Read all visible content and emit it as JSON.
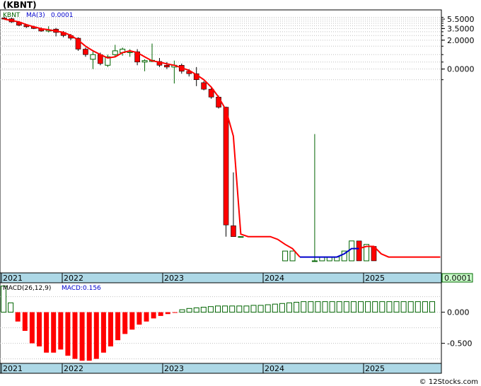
{
  "ticker_label": "(KBNT)",
  "credit": "© 12Stocks.com",
  "colors": {
    "up": "#006400",
    "down": "#ff0000",
    "ma": "#ff0000",
    "ma_recent": "#0000cc",
    "axis_band": "#add8e6",
    "grid": "#c0c0c0",
    "price_badge": "#ccffcc"
  },
  "chart_data": [
    {
      "type": "candlestick",
      "legend": {
        "symbol": "KBNT",
        "ma_label": "MA(3)",
        "ma_value": "0.0001"
      },
      "current_price_label": "0.0001",
      "y_scale": "log",
      "y_tick_labels": [
        "5.5000",
        "3.5000",
        "2.0000",
        "0.0000"
      ],
      "x_tick_labels": [
        "2021",
        "2022",
        "2023",
        "2024",
        "2025"
      ],
      "candles": [
        {
          "o": 5.8,
          "h": 6.2,
          "l": 5.4,
          "c": 5.5
        },
        {
          "o": 5.6,
          "h": 5.9,
          "l": 4.6,
          "c": 4.8
        },
        {
          "o": 4.7,
          "h": 5.0,
          "l": 3.9,
          "c": 4.1
        },
        {
          "o": 4.1,
          "h": 4.3,
          "l": 3.6,
          "c": 3.8
        },
        {
          "o": 3.8,
          "h": 4.0,
          "l": 3.4,
          "c": 3.5
        },
        {
          "o": 3.5,
          "h": 3.7,
          "l": 3.0,
          "c": 3.1
        },
        {
          "o": 3.1,
          "h": 3.9,
          "l": 2.9,
          "c": 3.3
        },
        {
          "o": 3.4,
          "h": 3.6,
          "l": 2.4,
          "c": 2.9
        },
        {
          "o": 2.9,
          "h": 3.1,
          "l": 2.3,
          "c": 2.5
        },
        {
          "o": 2.5,
          "h": 2.7,
          "l": 2.0,
          "c": 2.2
        },
        {
          "o": 2.2,
          "h": 2.3,
          "l": 1.2,
          "c": 1.3
        },
        {
          "o": 1.3,
          "h": 1.4,
          "l": 0.9,
          "c": 1.0
        },
        {
          "o": 0.8,
          "h": 1.2,
          "l": 0.5,
          "c": 1.0
        },
        {
          "o": 1.0,
          "h": 1.1,
          "l": 0.6,
          "c": 0.65
        },
        {
          "o": 0.6,
          "h": 1.0,
          "l": 0.55,
          "c": 0.9
        },
        {
          "o": 1.0,
          "h": 1.6,
          "l": 0.9,
          "c": 1.2
        },
        {
          "o": 1.1,
          "h": 1.4,
          "l": 0.95,
          "c": 1.3
        },
        {
          "o": 1.1,
          "h": 1.3,
          "l": 0.9,
          "c": 1.15
        },
        {
          "o": 1.15,
          "h": 1.3,
          "l": 0.6,
          "c": 0.7
        },
        {
          "o": 0.7,
          "h": 0.8,
          "l": 0.45,
          "c": 0.75
        },
        {
          "o": 0.72,
          "h": 1.7,
          "l": 0.7,
          "c": 0.76
        },
        {
          "o": 0.72,
          "h": 0.85,
          "l": 0.55,
          "c": 0.6
        },
        {
          "o": 0.6,
          "h": 0.7,
          "l": 0.5,
          "c": 0.55
        },
        {
          "o": 0.55,
          "h": 0.75,
          "l": 0.25,
          "c": 0.6
        },
        {
          "o": 0.6,
          "h": 0.65,
          "l": 0.4,
          "c": 0.45
        },
        {
          "o": 0.45,
          "h": 0.5,
          "l": 0.35,
          "c": 0.4
        },
        {
          "o": 0.4,
          "h": 0.55,
          "l": 0.22,
          "c": 0.3
        },
        {
          "o": 0.26,
          "h": 0.28,
          "l": 0.18,
          "c": 0.19
        },
        {
          "o": 0.19,
          "h": 0.2,
          "l": 0.12,
          "c": 0.13
        },
        {
          "o": 0.13,
          "h": 0.14,
          "l": 0.075,
          "c": 0.08
        },
        {
          "o": 0.08,
          "h": 0.082,
          "l": 0.00016,
          "c": 0.00028
        },
        {
          "o": 0.00027,
          "h": 0.0035,
          "l": 0.00016,
          "c": 0.00016
        },
        {
          "o": 0.00016,
          "h": 0.00016,
          "l": 0.00016,
          "c": 0.00016
        },
        null,
        null,
        null,
        null,
        null,
        {
          "o": 5e-05,
          "h": 8e-05,
          "l": 5e-05,
          "c": 8e-05
        },
        {
          "o": 5e-05,
          "h": 8e-05,
          "l": 5e-05,
          "c": 8e-05
        },
        null,
        null,
        {
          "o": 5e-05,
          "h": 0.022,
          "l": 5e-05,
          "c": 5e-05
        },
        {
          "o": 5e-05,
          "h": 6e-05,
          "l": 5e-05,
          "c": 6e-05
        },
        {
          "o": 5e-05,
          "h": 6e-05,
          "l": 5e-05,
          "c": 6e-05
        },
        {
          "o": 5e-05,
          "h": 6e-05,
          "l": 5e-05,
          "c": 6e-05
        },
        {
          "o": 5e-05,
          "h": 8e-05,
          "l": 5e-05,
          "c": 8e-05
        },
        {
          "o": 5e-05,
          "h": 0.00013,
          "l": 5e-05,
          "c": 0.00013
        },
        {
          "o": 0.00013,
          "h": 0.00013,
          "l": 5e-05,
          "c": 5e-05
        },
        {
          "o": 5e-05,
          "h": 0.00011,
          "l": 5e-05,
          "c": 0.00011
        },
        {
          "o": 0.0001,
          "h": 0.0001,
          "l": 5e-05,
          "c": 5e-05
        },
        null,
        null,
        null,
        null,
        null,
        null,
        null,
        null
      ],
      "ma": [
        5.5,
        5.15,
        4.8,
        4.23,
        3.8,
        3.47,
        3.3,
        3.1,
        2.9,
        2.53,
        2.0,
        1.5,
        1.2,
        1.0,
        0.85,
        0.9,
        1.1,
        1.2,
        1.1,
        0.9,
        0.74,
        0.7,
        0.64,
        0.6,
        0.53,
        0.47,
        0.38,
        0.3,
        0.21,
        0.13,
        0.07,
        0.02,
        0.00018,
        0.00016,
        0.00016,
        0.00016,
        0.00016,
        0.00014,
        0.00011,
        9e-05,
        6e-05,
        6e-05,
        6e-05,
        6e-05,
        6e-05,
        6e-05,
        7e-05,
        9e-05,
        9e-05,
        0.0001,
        0.0001,
        7e-05,
        6e-05,
        6e-05,
        6e-05,
        6e-05,
        6e-05,
        6e-05,
        6e-05,
        6e-05
      ],
      "ma_blue_start": 40,
      "ma_blue_end": 48
    },
    {
      "type": "bar",
      "legend": {
        "label": "MACD(26,12,9)",
        "value_label": "MACD:0.156"
      },
      "y_tick_labels": [
        "0.000",
        "-0.500"
      ],
      "x_tick_labels": [
        "2021",
        "2022",
        "2023",
        "2024",
        "2025"
      ],
      "ylim": [
        -0.8,
        0.45
      ],
      "values": [
        0.42,
        0.15,
        -0.15,
        -0.3,
        -0.5,
        -0.55,
        -0.65,
        -0.65,
        -0.6,
        -0.7,
        -0.75,
        -0.78,
        -0.78,
        -0.75,
        -0.65,
        -0.55,
        -0.45,
        -0.35,
        -0.28,
        -0.2,
        -0.15,
        -0.1,
        -0.06,
        -0.03,
        -0.01,
        0.04,
        0.06,
        0.07,
        0.08,
        0.09,
        0.1,
        0.1,
        0.1,
        0.1,
        0.1,
        0.11,
        0.11,
        0.12,
        0.13,
        0.14,
        0.15,
        0.16,
        0.17,
        0.17,
        0.17,
        0.17,
        0.17,
        0.17,
        0.17,
        0.17,
        0.17,
        0.17,
        0.17,
        0.17,
        0.17,
        0.17,
        0.17,
        0.17,
        0.17,
        0.17,
        0.17
      ]
    }
  ]
}
